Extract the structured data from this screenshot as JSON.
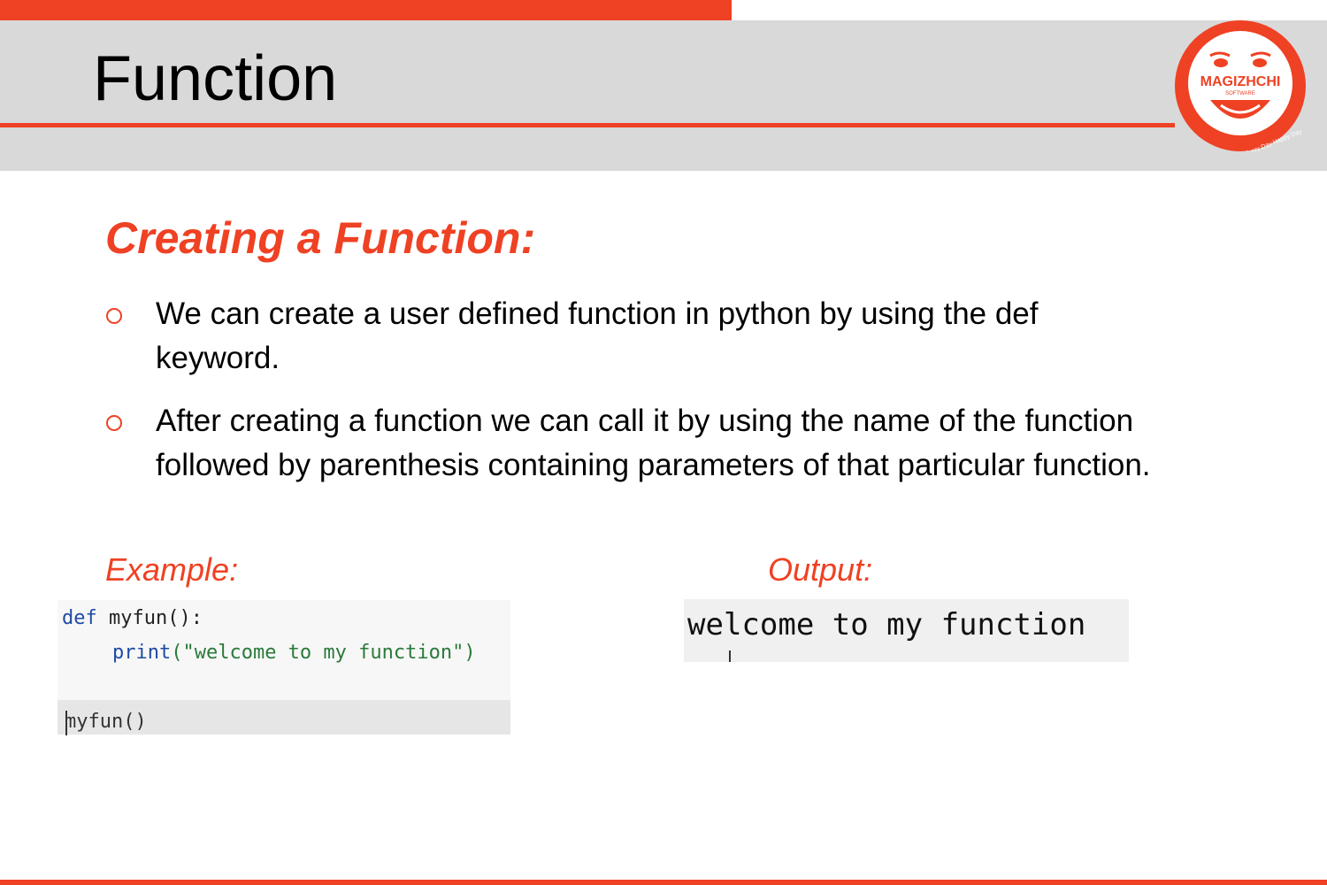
{
  "header": {
    "title": "Function",
    "logo": {
      "name": "MAGIZHCHI",
      "sub": "SOFTWARE",
      "tagline": "Every Day Happy Day"
    }
  },
  "main": {
    "heading": "Creating a Function:",
    "bullets": [
      "We can create a user defined function in python by using the def keyword.",
      "After creating a function we can call it by using the name of the function followed by parenthesis containing parameters of that particular function."
    ],
    "example_label": "Example:",
    "output_label": "Output:",
    "code": {
      "def_keyword": "def",
      "def_rest": "myfun():",
      "print_keyword": "print",
      "print_string": "(\"welcome to my function\")",
      "call": "myfun()"
    },
    "output_text": "welcome to my function"
  },
  "colors": {
    "accent": "#ef4123",
    "header_band": "#d9d9d9",
    "text": "#000000"
  }
}
